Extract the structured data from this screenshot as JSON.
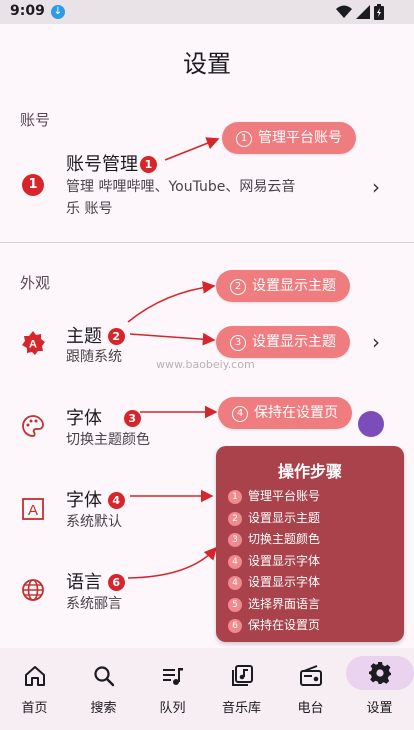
{
  "status_bar": {
    "time": "9:09"
  },
  "page": {
    "title": "设置"
  },
  "sections": {
    "account": {
      "label": "账号"
    },
    "appearance": {
      "label": "外观"
    }
  },
  "rows": {
    "account_management": {
      "title": "账号管理",
      "badge": "1",
      "subtitle_line1": "管理 哔哩哔哩、YouTube、网易云音",
      "subtitle_line2": "乐 账号",
      "icon_number": "1"
    },
    "theme": {
      "title": "主题",
      "badge": "2",
      "subtitle": "跟随系统"
    },
    "font": {
      "title": "字体",
      "badge": "3",
      "subtitle": "切换主题颜色"
    },
    "font2": {
      "title": "字体",
      "badge": "4",
      "subtitle": "系统默认"
    },
    "language": {
      "title": "语言",
      "badge": "6",
      "subtitle": "系统郦言"
    }
  },
  "callouts": [
    {
      "num": "1",
      "text": "管理平台账号"
    },
    {
      "num": "2",
      "text": "设置显示主题"
    },
    {
      "num": "3",
      "text": "设置显示主题"
    },
    {
      "num": "4",
      "text": "保持在设置页"
    }
  ],
  "steps": {
    "title": "操作步骤",
    "items": [
      {
        "num": "1",
        "text": "管理平台账号"
      },
      {
        "num": "2",
        "text": "设置显示主题"
      },
      {
        "num": "3",
        "text": "切换主题颜色"
      },
      {
        "num": "4",
        "text": "设置显示字体"
      },
      {
        "num": "4",
        "text": "设置显示字体"
      },
      {
        "num": "5",
        "text": "选择界面语言"
      },
      {
        "num": "6",
        "text": "保持在设置页"
      }
    ]
  },
  "watermark": "www.baobeiy.com",
  "nav": [
    {
      "label": "首页",
      "icon": "home-icon"
    },
    {
      "label": "搜索",
      "icon": "search-icon"
    },
    {
      "label": "队列",
      "icon": "queue-icon"
    },
    {
      "label": "音乐库",
      "icon": "library-icon"
    },
    {
      "label": "电台",
      "icon": "radio-icon"
    },
    {
      "label": "设置",
      "icon": "gear-icon",
      "active": true
    }
  ],
  "colors": {
    "accent_red": "#d7262b",
    "callout_pill": "#ef7c7f",
    "steps_box": "#a9424a",
    "active_nav": "#e9d3ee"
  }
}
